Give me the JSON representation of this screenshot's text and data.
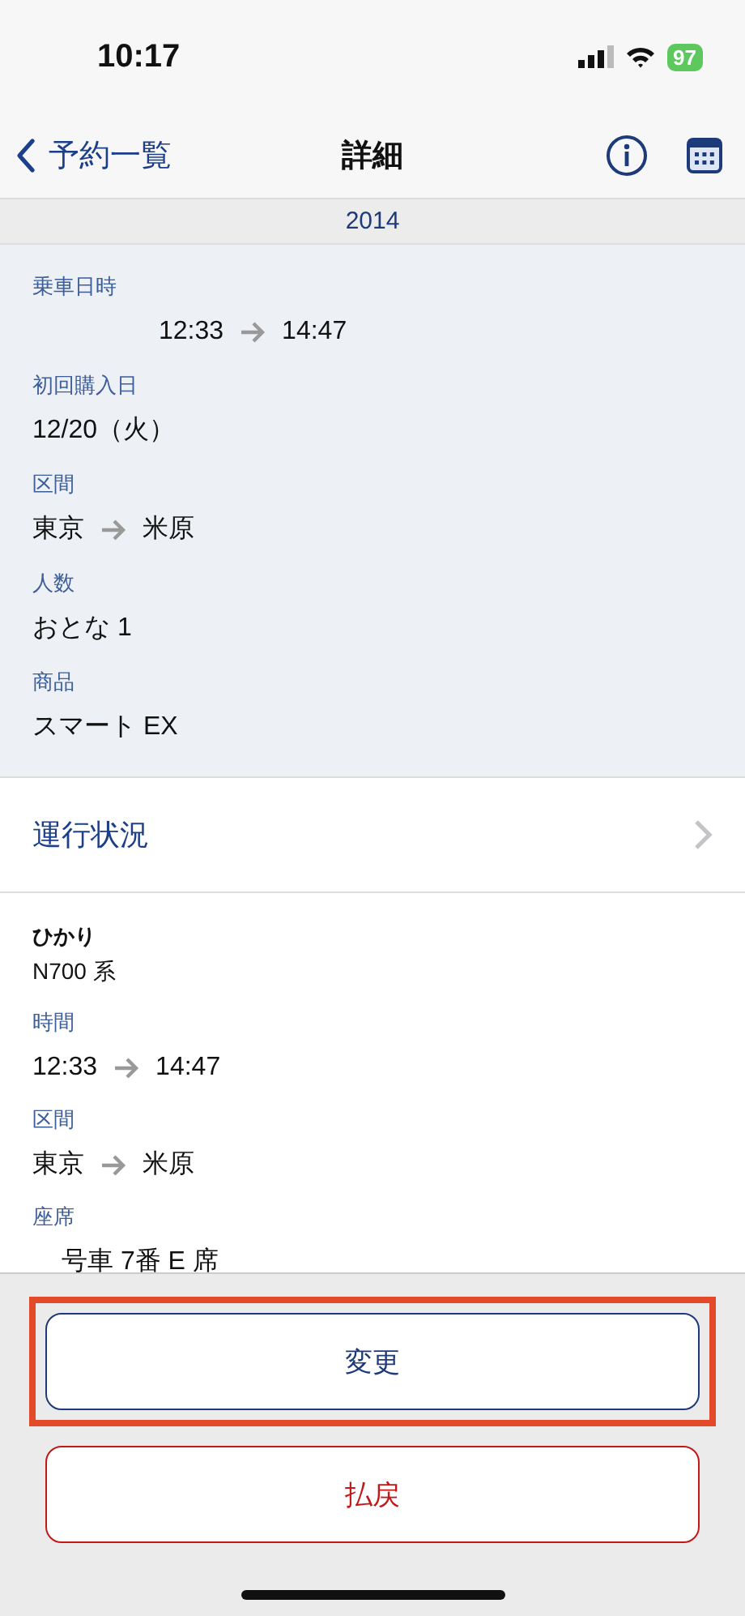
{
  "status_bar": {
    "time": "10:17",
    "battery": "97"
  },
  "nav": {
    "back": "予約一覧",
    "title": "詳細"
  },
  "year": "2014",
  "summary": [
    {
      "kind": "route",
      "indented": true,
      "label": "乗車日時",
      "from": "12:33",
      "to": "14:47"
    },
    {
      "kind": "text",
      "indented": false,
      "label": "初回購入日",
      "value": "12/20（火）"
    },
    {
      "kind": "route",
      "indented": false,
      "label": "区間",
      "from": "東京",
      "to": "米原"
    },
    {
      "kind": "text",
      "indented": false,
      "label": "人数",
      "value": "おとな 1"
    },
    {
      "kind": "text",
      "indented": false,
      "label": "商品",
      "value": "スマート EX"
    }
  ],
  "status_link": "運行状況",
  "train": {
    "name": "ひかり",
    "type": "N700 系"
  },
  "details": [
    {
      "kind": "route",
      "indented": false,
      "label": "時間",
      "from": "12:33",
      "to": "14:47"
    },
    {
      "kind": "route",
      "indented": false,
      "label": "区間",
      "from": "東京",
      "to": "米原"
    },
    {
      "kind": "text",
      "indented": true,
      "label": "座席",
      "value": "号車 7番 E 席"
    }
  ],
  "buttons": [
    {
      "label": "変更",
      "kind": "primary",
      "highlighted": true
    },
    {
      "label": "払戻",
      "kind": "danger",
      "highlighted": false
    }
  ]
}
